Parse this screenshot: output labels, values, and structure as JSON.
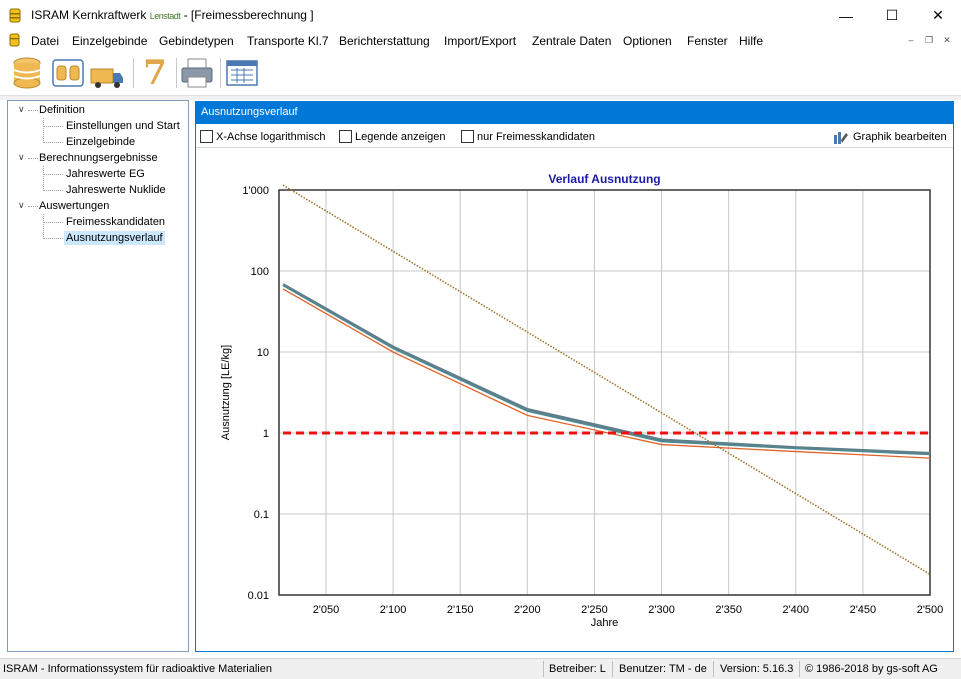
{
  "window": {
    "title": "ISRAM Kernkraftwerk ",
    "title_plant": "Lenstadt",
    "title_suffix": " - [Freimessberechnung ]",
    "min_glyph": "—",
    "max_glyph": "☐",
    "close_glyph": "✕"
  },
  "menu": {
    "items": [
      "Datei",
      "Einzelgebinde",
      "Gebindetypen",
      "Transporte Kl.7",
      "Berichterstattung",
      "Import/Export",
      "Zentrale Daten",
      "Optionen",
      "Fenster",
      "Hilfe"
    ],
    "mdi_min": "–",
    "mdi_restore": "❐",
    "mdi_close": "✕"
  },
  "toolbar": {
    "icons": [
      "database-icon",
      "container-group-icon",
      "transport-truck-icon",
      "class-7-icon",
      "printer-icon",
      "calculator-grid-icon"
    ],
    "class7_label": "7"
  },
  "tree": {
    "nodes": [
      {
        "label": "Definition",
        "level": 0,
        "expanded": true
      },
      {
        "label": "Einstellungen und Start",
        "level": 1
      },
      {
        "label": "Einzelgebinde",
        "level": 1
      },
      {
        "label": "Berechnungsergebnisse",
        "level": 0,
        "expanded": true
      },
      {
        "label": "Jahreswerte EG",
        "level": 1
      },
      {
        "label": "Jahreswerte Nuklide",
        "level": 1
      },
      {
        "label": "Auswertungen",
        "level": 0,
        "expanded": true
      },
      {
        "label": "Freimesskandidaten",
        "level": 1
      },
      {
        "label": "Ausnutzungsverlauf",
        "level": 1,
        "selected": true
      }
    ],
    "expander_glyph": "∨"
  },
  "panel": {
    "header": "Ausnutzungsverlauf",
    "options": {
      "log_x": {
        "label": "X-Achse logarithmisch",
        "checked": false
      },
      "legend": {
        "label": "Legende anzeigen",
        "checked": false
      },
      "candidates": {
        "label": "nur Freimesskandidaten",
        "checked": false
      }
    },
    "edit_graph_label": "Graphik bearbeiten"
  },
  "chart_data": {
    "type": "line",
    "title": "Verlauf Ausnutzung",
    "xlabel": "Jahre",
    "ylabel": "Ausnutzung [LE/kg]",
    "xlim": [
      2015,
      2500
    ],
    "ylim": [
      0.01,
      1000
    ],
    "y_scale": "log",
    "grid": true,
    "x_ticks": [
      2050,
      2100,
      2150,
      2200,
      2250,
      2300,
      2350,
      2400,
      2450,
      2500
    ],
    "x_tick_labels": [
      "2'050",
      "2'100",
      "2'150",
      "2'200",
      "2'250",
      "2'300",
      "2'350",
      "2'400",
      "2'450",
      "2'500"
    ],
    "y_ticks": [
      0.01,
      0.1,
      1,
      10,
      100,
      1000
    ],
    "y_tick_labels": [
      "0.01",
      "0.1",
      "1",
      "10",
      "100",
      "1'000"
    ],
    "colors": {
      "grey": "#5f7f8a",
      "teal": "#4a8a94",
      "orange": "#e0642a",
      "brown": "#a0742c",
      "limit": "#ee1111",
      "title": "#1a1aa6"
    },
    "series": [
      {
        "x": [
          2018,
          2100,
          2200,
          2300,
          2400,
          2500
        ],
        "y": [
          68,
          11.5,
          1.95,
          0.82,
          0.66,
          0.56
        ]
      },
      {
        "x": [
          2018,
          2100,
          2200,
          2300,
          2400,
          2500
        ],
        "y": [
          66,
          11,
          1.85,
          0.78,
          0.64,
          0.54
        ]
      },
      {
        "x": [
          2018,
          2100,
          2200,
          2300,
          2400,
          2500
        ],
        "y": [
          60,
          10,
          1.65,
          0.72,
          0.59,
          0.49
        ]
      },
      {
        "x": [
          2018,
          2500
        ],
        "y": [
          1150,
          0.018
        ]
      },
      {
        "x": [
          2018,
          2500
        ],
        "y": [
          1,
          1
        ],
        "dashed": true
      }
    ]
  },
  "status": {
    "app": "ISRAM - Informationssystem für radioaktive Materialien",
    "operator": "Betreiber: L",
    "user": "Benutzer: TM - de",
    "version": "Version: 5.16.3",
    "copyright": "© 1986-2018 by gs-soft AG"
  }
}
